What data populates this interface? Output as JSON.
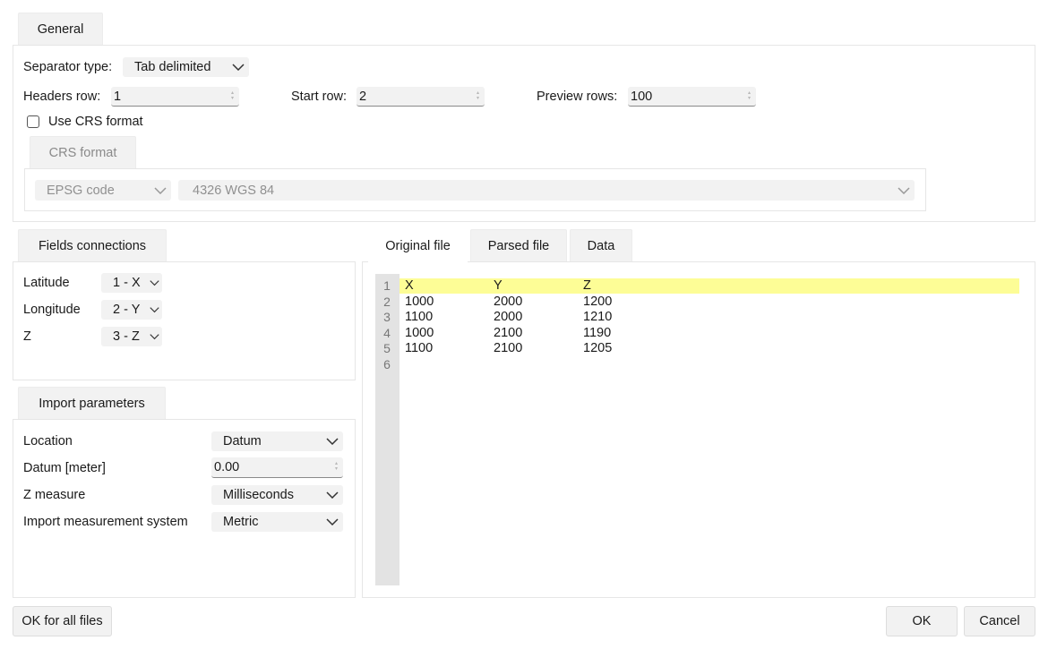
{
  "general": {
    "tab_label": "General",
    "separator_label": "Separator type:",
    "separator_value": "Tab delimited",
    "headers_label": "Headers row:",
    "headers_value": "1",
    "start_label": "Start row:",
    "start_value": "2",
    "preview_label": "Preview rows:",
    "preview_value": "100",
    "use_crs_label": "Use CRS format",
    "crs_tab_label": "CRS format",
    "crs_type_value": "EPSG code",
    "crs_code_value": "4326 WGS 84"
  },
  "fields": {
    "tab_label": "Fields connections",
    "items": [
      {
        "label": "Latitude",
        "value": "1 - X"
      },
      {
        "label": "Longitude",
        "value": "2 - Y"
      },
      {
        "label": "Z",
        "value": "3 - Z"
      }
    ]
  },
  "import_params": {
    "tab_label": "Import parameters",
    "location_label": "Location",
    "location_value": "Datum",
    "datum_label": "Datum [meter]",
    "datum_value": "0.00",
    "zmeasure_label": "Z measure",
    "zmeasure_value": "Milliseconds",
    "system_label": "Import measurement system",
    "system_value": "Metric"
  },
  "preview": {
    "tabs": [
      "Original file",
      "Parsed file",
      "Data"
    ],
    "line_numbers": [
      "1",
      "2",
      "3",
      "4",
      "5",
      "6"
    ],
    "rows": [
      [
        "X",
        "Y",
        "Z"
      ],
      [
        "1000",
        "2000",
        "1200"
      ],
      [
        "1100",
        "2000",
        "1210"
      ],
      [
        "1000",
        "2100",
        "1190"
      ],
      [
        "1100",
        "2100",
        "1205"
      ]
    ],
    "highlight_color": "#fdfd96"
  },
  "footer": {
    "ok_all_label": "OK for all files",
    "ok_label": "OK",
    "cancel_label": "Cancel"
  }
}
